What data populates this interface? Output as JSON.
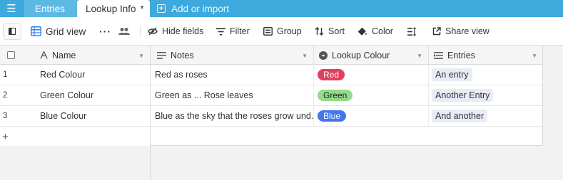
{
  "tabs": {
    "entries": "Entries",
    "lookup_info": "Lookup Info",
    "add_or_import": "Add or import"
  },
  "toolbar": {
    "view_name": "Grid view",
    "hide_fields": "Hide fields",
    "filter": "Filter",
    "group": "Group",
    "sort": "Sort",
    "color": "Color",
    "share_view": "Share view"
  },
  "columns": {
    "name": "Name",
    "notes": "Notes",
    "lookup_colour": "Lookup Colour",
    "entries": "Entries"
  },
  "rows": [
    {
      "num": "1",
      "name": "Red Colour",
      "notes": "Red as roses",
      "colour": {
        "label": "Red",
        "bg": "#e0405e",
        "fg": "#ffffff"
      },
      "entry": "An entry"
    },
    {
      "num": "2",
      "name": "Green Colour",
      "notes": "Green as ... Rose leaves",
      "colour": {
        "label": "Green",
        "bg": "#93db8b",
        "fg": "#222222"
      },
      "entry": "Another Entry"
    },
    {
      "num": "3",
      "name": "Blue Colour",
      "notes": "Blue as the sky that the roses grow und...",
      "colour": {
        "label": "Blue",
        "bg": "#4477ee",
        "fg": "#ffffff"
      },
      "entry": "And another"
    }
  ],
  "add_row_symbol": "+",
  "colors": {
    "tabbar": "#3da9dc",
    "accent_blue": "#2d7ff9"
  }
}
